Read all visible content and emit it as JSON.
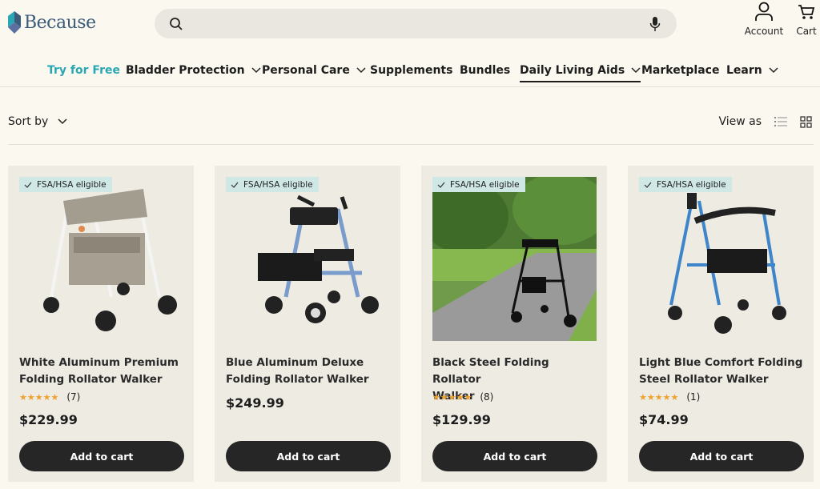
{
  "brand": {
    "name": "Because"
  },
  "header": {
    "account_label": "Account",
    "cart_label": "Cart",
    "search_placeholder": ""
  },
  "nav": [
    {
      "label": "Try for Free",
      "dropdown": false
    },
    {
      "label": "Bladder Protection",
      "dropdown": true
    },
    {
      "label": "Personal Care",
      "dropdown": true
    },
    {
      "label": "Supplements",
      "dropdown": false
    },
    {
      "label": "Bundles",
      "dropdown": false
    },
    {
      "label": "Daily Living Aids",
      "dropdown": true
    },
    {
      "label": "Marketplace",
      "dropdown": false
    },
    {
      "label": "Learn",
      "dropdown": true
    }
  ],
  "toolbar": {
    "sort_label": "Sort by",
    "view_label": "View as"
  },
  "products": [
    {
      "badge": "FSA/HSA eligible",
      "name_line1": "White Aluminum Premium",
      "name_line2": "Folding Rollator Walker",
      "stars": "★★★★★",
      "rating": 4.5,
      "reviews": "(7)",
      "price": "$229.99",
      "cta": "Add to cart"
    },
    {
      "badge": "FSA/HSA eligible",
      "name_line1": "Blue Aluminum Deluxe",
      "name_line2": "Folding Rollator Walker",
      "stars": "",
      "reviews": "",
      "price": "$249.99",
      "cta": "Add to cart"
    },
    {
      "badge": "FSA/HSA eligible",
      "name_line1": "Black Steel Folding Rollator",
      "name_line2": "Walker",
      "stars": "★★★★★",
      "rating": 5,
      "reviews": "(8)",
      "price": "$129.99",
      "cta": "Add to cart"
    },
    {
      "badge": "FSA/HSA eligible",
      "name_line1": "Light Blue Comfort Folding",
      "name_line2": "Steel Rollator Walker",
      "stars": "★★★★★",
      "rating": 5,
      "reviews": "(1)",
      "price": "$74.99",
      "cta": "Add to cart"
    }
  ],
  "colors": {
    "accent": "#2aa7b4",
    "badge_bg": "#cfe8e6",
    "button_bg": "#262626",
    "star": "#f0a030",
    "brand": "#3b5b7a"
  }
}
